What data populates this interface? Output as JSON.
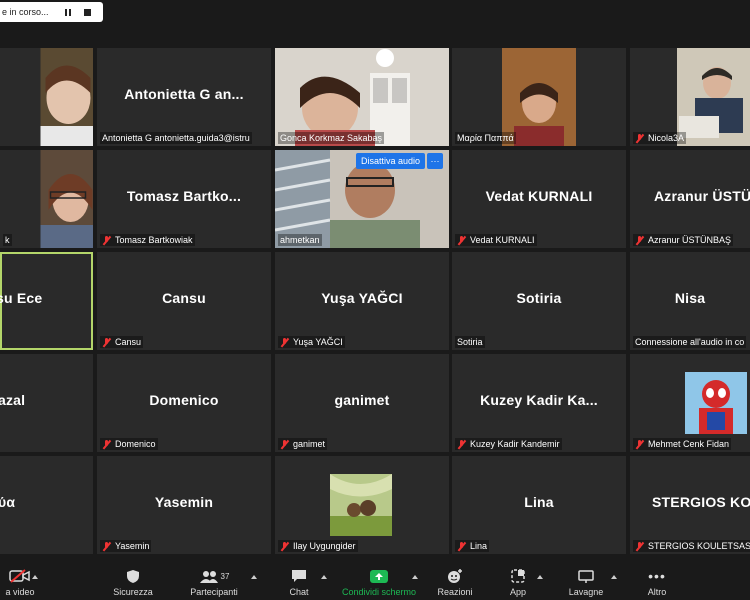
{
  "recording": {
    "text": "e in corso..."
  },
  "popup": {
    "label": "Disattiva audio",
    "more": "···"
  },
  "tiles": [
    {
      "name_label": "",
      "big": "",
      "muted": false
    },
    {
      "name_label": "Antonietta G antonietta.guida3@istru",
      "big": "Antonietta G an...",
      "muted": false
    },
    {
      "name_label": "Gonca Korkmaz Sakabaş",
      "big": "",
      "muted": false
    },
    {
      "name_label": "Μαρία Παππά",
      "big": "",
      "muted": false
    },
    {
      "name_label": "Nicola3A",
      "big": "",
      "muted": true
    },
    {
      "name_label": "k",
      "big": "",
      "muted": false
    },
    {
      "name_label": "Tomasz Bartkowiak",
      "big": "Tomasz Bartko...",
      "muted": true
    },
    {
      "name_label": "ahmetkan",
      "big": "",
      "muted": false
    },
    {
      "name_label": "Vedat KURNALI",
      "big": "Vedat KURNALI",
      "muted": true
    },
    {
      "name_label": "Azranur ÜSTÜNBAŞ",
      "big": "Azranur ÜSTÜ",
      "muted": true
    },
    {
      "name_label": "",
      "big": "su Ece",
      "muted": false
    },
    {
      "name_label": "Cansu",
      "big": "Cansu",
      "muted": true
    },
    {
      "name_label": "Yuşa YAĞCI",
      "big": "Yuşa YAĞCI",
      "muted": true
    },
    {
      "name_label": "Sotiria",
      "big": "Sotiria",
      "muted": false
    },
    {
      "name_label": "Connessione all'audio in co",
      "big": "Nisa",
      "muted": false
    },
    {
      "name_label": "",
      "big": "azal",
      "muted": false
    },
    {
      "name_label": "Domenico",
      "big": "Domenico",
      "muted": true
    },
    {
      "name_label": "ganimet",
      "big": "ganimet",
      "muted": true
    },
    {
      "name_label": "Kuzey Kadir Kandemir",
      "big": "Kuzey Kadir Ka...",
      "muted": true
    },
    {
      "name_label": "Mehmet Cenk Fidan",
      "big": "",
      "muted": true
    },
    {
      "name_label": "",
      "big": "ύα",
      "muted": false
    },
    {
      "name_label": "Yasemin",
      "big": "Yasemin",
      "muted": true
    },
    {
      "name_label": "Ilay Uygungider",
      "big": "",
      "muted": true
    },
    {
      "name_label": "Lina",
      "big": "Lina",
      "muted": true
    },
    {
      "name_label": "STERGIOS KOULETSAS",
      "big": "STERGIOS KO",
      "muted": true
    }
  ],
  "toolbar": {
    "video": "a video",
    "security": "Sicurezza",
    "participants": "Partecipanti",
    "participants_count": "37",
    "chat": "Chat",
    "share": "Condividi schermo",
    "reactions": "Reazioni",
    "apps": "App",
    "whiteboard": "Lavagne",
    "more": "Altro"
  },
  "colors": {
    "accent": "#1e74e8",
    "share": "#1db954",
    "active_speaker": "#b4d66a",
    "muted": "#e33333"
  }
}
